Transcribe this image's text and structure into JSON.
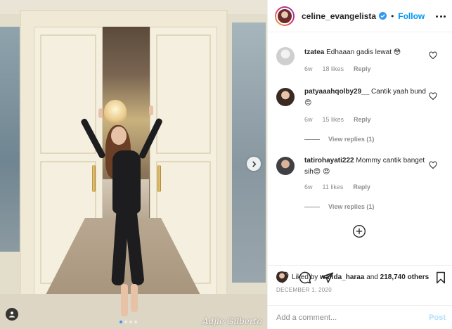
{
  "post": {
    "username": "celine_evangelista",
    "follow_separator": "•",
    "follow_label": "Follow",
    "watermark": "Adjie Gilberto",
    "carousel_total": 4,
    "carousel_active": 1
  },
  "comments": [
    {
      "user": "tzatea",
      "text": "Edhaaan gadis lewat 😳",
      "age": "6w",
      "likes": "18 likes",
      "reply": "Reply",
      "view_replies": ""
    },
    {
      "user": "patyaaahqolby29__",
      "text": "Cantik yaah bund😍",
      "age": "6w",
      "likes": "15 likes",
      "reply": "Reply",
      "view_replies": "View replies (1)"
    },
    {
      "user": "tatirohayati222",
      "text": "Mommy cantik banget sih😍 😍",
      "age": "6w",
      "likes": "11 likes",
      "reply": "Reply",
      "view_replies": "View replies (1)"
    }
  ],
  "footer": {
    "liked_by_prefix": "Liked by",
    "liked_by_user": "wanda_haraa",
    "liked_by_middle": "and",
    "liked_by_count": "218,740 others",
    "date": "DECEMBER 1, 2020",
    "comment_placeholder": "Add a comment...",
    "post_label": "Post"
  },
  "colors": {
    "accent": "#0095f6",
    "muted": "#8e8e8e",
    "text": "#262626",
    "post_disabled": "#b2dffc"
  },
  "icons": [
    "verified-badge-icon",
    "more-options-icon",
    "heart-icon",
    "comment-icon",
    "share-icon",
    "save-icon",
    "add-circle-icon",
    "chevron-right-icon",
    "user-tag-icon"
  ]
}
